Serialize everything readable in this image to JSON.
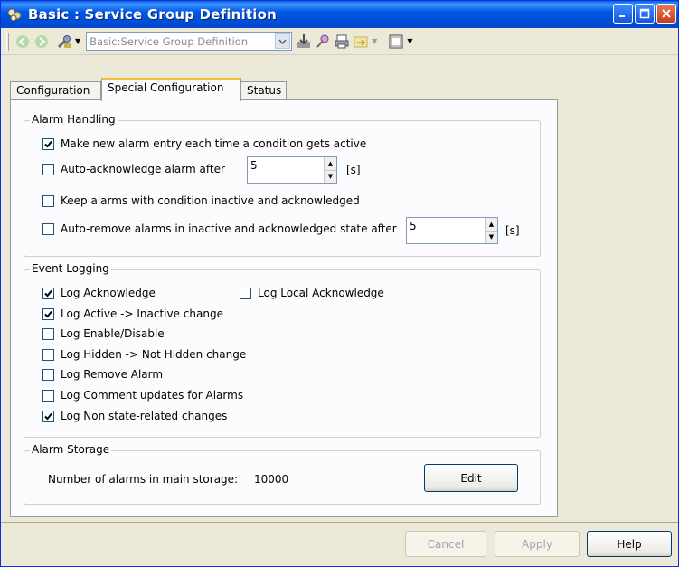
{
  "window": {
    "title": "Basic : Service Group Definition"
  },
  "toolbar": {
    "combo_value": "Basic:Service Group Definition"
  },
  "tabs": [
    {
      "label": "Configuration"
    },
    {
      "label": "Special Configuration"
    },
    {
      "label": "Status"
    }
  ],
  "alarm_handling": {
    "title": "Alarm Handling",
    "new_entry": {
      "label": "Make new alarm entry each time a condition gets active",
      "checked": true
    },
    "auto_ack": {
      "label": "Auto-acknowledge alarm after",
      "checked": false,
      "value": "5",
      "unit": "[s]"
    },
    "keep_alarms": {
      "label": "Keep alarms with condition inactive and acknowledged",
      "checked": false
    },
    "auto_remove": {
      "label": "Auto-remove alarms in inactive and acknowledged state after",
      "checked": false,
      "value": "5",
      "unit": "[s]"
    }
  },
  "event_logging": {
    "title": "Event Logging",
    "log_ack": {
      "label": "Log Acknowledge",
      "checked": true
    },
    "log_local_ack": {
      "label": "Log Local Acknowledge",
      "checked": false
    },
    "log_active": {
      "label": "Log Active -> Inactive change",
      "checked": true
    },
    "log_enable": {
      "label": "Log Enable/Disable",
      "checked": false
    },
    "log_hidden": {
      "label": "Log Hidden -> Not Hidden change",
      "checked": false
    },
    "log_remove": {
      "label": "Log Remove Alarm",
      "checked": false
    },
    "log_comment": {
      "label": "Log Comment updates for Alarms",
      "checked": false
    },
    "log_nonstate": {
      "label": "Log Non state-related changes",
      "checked": true
    }
  },
  "alarm_storage": {
    "title": "Alarm Storage",
    "label": "Number of alarms in main storage:",
    "value": "10000",
    "edit_label": "Edit"
  },
  "footer": {
    "cancel": "Cancel",
    "apply": "Apply",
    "help": "Help"
  }
}
